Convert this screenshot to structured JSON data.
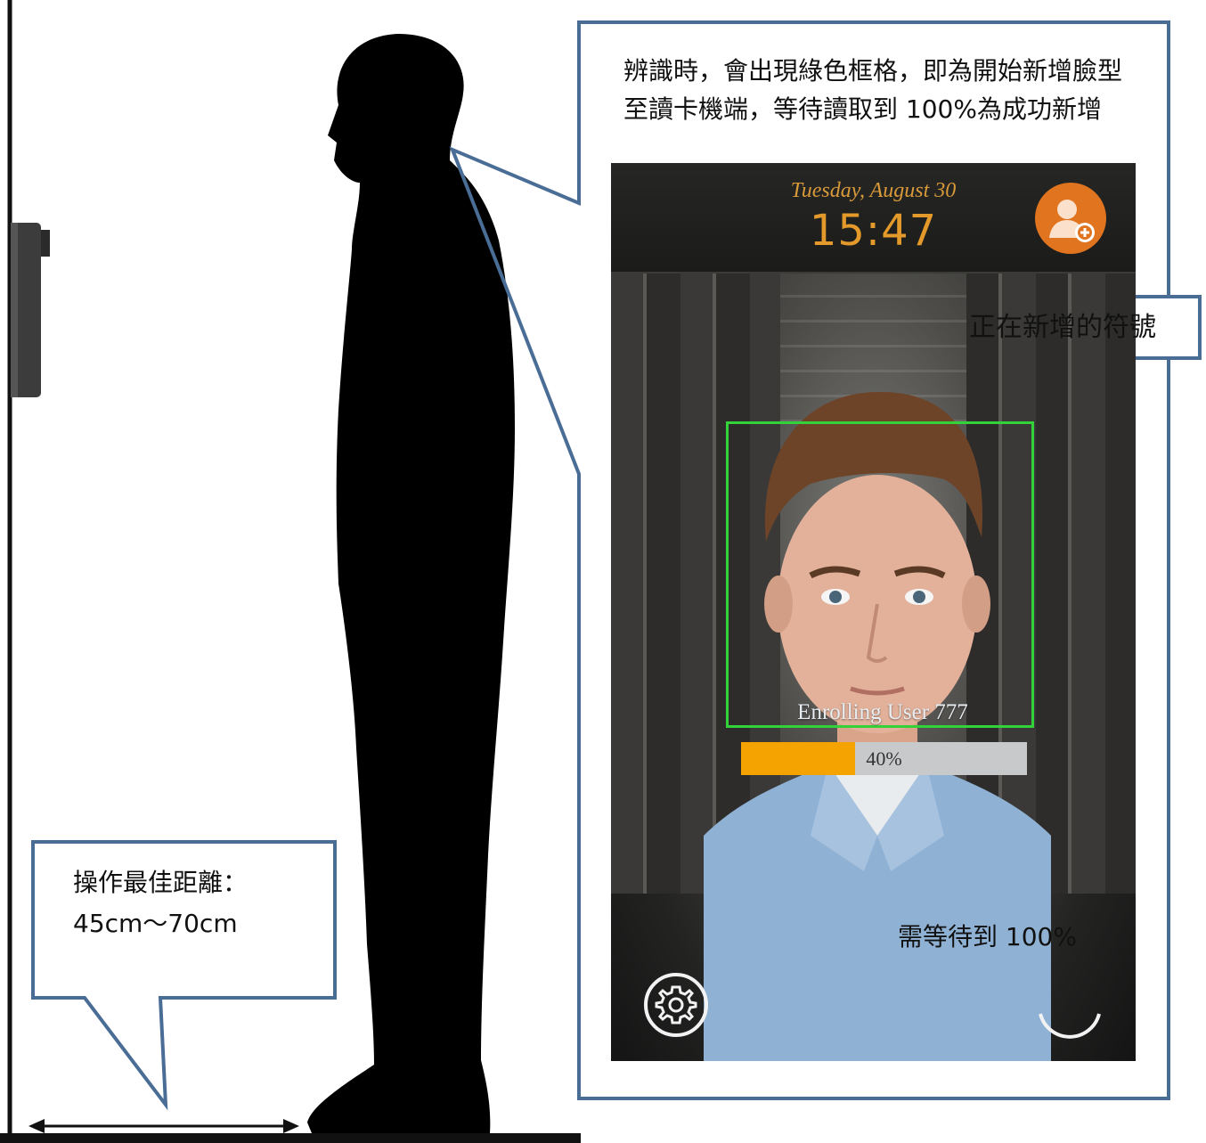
{
  "callout_main": {
    "line1": "辨識時，會出現綠色框格，即為開始新增臉型",
    "line2": "至讀卡機端，等待讀取到 100%為成功新增"
  },
  "callout_symbol": {
    "text": "正在新增的符號"
  },
  "callout_wait": {
    "text": "需等待到 100%"
  },
  "callout_distance": {
    "line1": "操作最佳距離：",
    "line2": "45cm～70cm"
  },
  "device": {
    "date": "Tuesday, August 30",
    "time": "15:47",
    "enroll_label": "Enrolling User 777",
    "progress": {
      "value_pct": 40,
      "label": "40%"
    },
    "icons": {
      "enroll": "user-add-icon",
      "settings": "gear-icon"
    }
  },
  "colors": {
    "callout_border": "#4a6d96",
    "face_box": "#33d13a",
    "progress_fill": "#f4a300",
    "clock": "#e39a2a",
    "enroll_icon_bg": "#e0741f"
  }
}
